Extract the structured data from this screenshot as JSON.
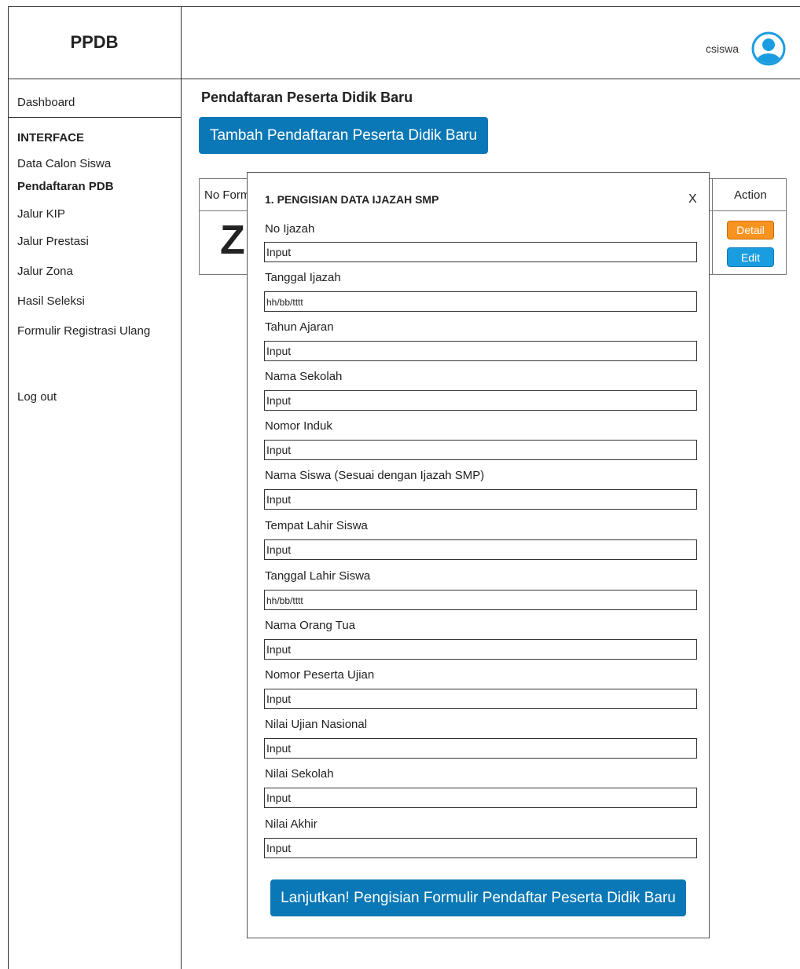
{
  "header": {
    "brand": "PPDB",
    "username": "csiswa",
    "avatar_icon": "user-avatar-icon",
    "avatar_color": "#1a9de0"
  },
  "sidebar": {
    "dashboard": "Dashboard",
    "section_heading": "INTERFACE",
    "items": [
      {
        "label": "Data Calon Siswa",
        "active": false
      },
      {
        "label": "Pendaftaran PDB",
        "active": true
      },
      {
        "label": "Jalur KIP",
        "active": false
      },
      {
        "label": "Jalur Prestasi",
        "active": false
      },
      {
        "label": "Jalur Zona",
        "active": false
      },
      {
        "label": "Hasil Seleksi",
        "active": false
      },
      {
        "label": "Formulir Registrasi Ulang",
        "active": false
      }
    ],
    "logout": "Log out"
  },
  "main": {
    "title": "Pendaftaran Peserta Didik Baru",
    "add_button": "Tambah Pendaftaran Peserta Didik Baru",
    "table": {
      "col_no": "No Form",
      "col_action": "Action",
      "row_initial": "Z",
      "detail_button": "Detail",
      "edit_button": "Edit"
    }
  },
  "modal": {
    "title": "1. PENGISIAN DATA IJAZAH SMP",
    "close": "X",
    "fields": [
      {
        "label": "No Ijazah",
        "placeholder": "Input"
      },
      {
        "label": "Tanggal Ijazah",
        "placeholder": "hh/bb/tttt"
      },
      {
        "label": "Tahun Ajaran",
        "placeholder": "Input"
      },
      {
        "label": "Nama Sekolah",
        "placeholder": "Input"
      },
      {
        "label": "Nomor Induk",
        "placeholder": "Input"
      },
      {
        "label": "Nama Siswa (Sesuai dengan Ijazah SMP)",
        "placeholder": "Input"
      },
      {
        "label": "Tempat Lahir Siswa",
        "placeholder": "Input"
      },
      {
        "label": "Tanggal Lahir Siswa",
        "placeholder": "hh/bb/tttt"
      },
      {
        "label": "Nama Orang Tua",
        "placeholder": "Input"
      },
      {
        "label": "Nomor Peserta Ujian",
        "placeholder": "Input"
      },
      {
        "label": "Nilai Ujian Nasional",
        "placeholder": "Input"
      },
      {
        "label": "Nilai Sekolah",
        "placeholder": "Input"
      },
      {
        "label": "Nilai Akhir",
        "placeholder": "Input"
      }
    ],
    "submit_button": "Lanjutkan! Pengisian Formulir Pendaftar Peserta Didik Baru"
  },
  "colors": {
    "primary_button": "#0a78b6",
    "detail_button": "#f7931e",
    "edit_button": "#1a9de0"
  }
}
